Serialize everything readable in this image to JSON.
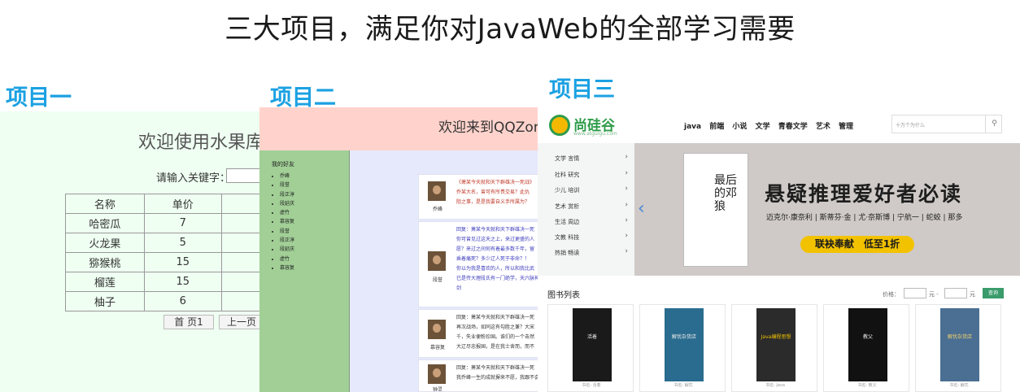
{
  "slide": {
    "title": "三大项目，满足你对JavaWeb的全部学习需要"
  },
  "labels": {
    "p1": "项目一",
    "p2": "项目二",
    "p3": "项目三"
  },
  "p1": {
    "title": "欢迎使用水果库",
    "search_label": "请输入关键字：",
    "columns": [
      "名称",
      "单价"
    ],
    "rows": [
      {
        "name": "哈密瓜",
        "price": "7"
      },
      {
        "name": "火龙果",
        "price": "5"
      },
      {
        "name": "猕猴桃",
        "price": "15"
      },
      {
        "name": "榴莲",
        "price": "15"
      },
      {
        "name": "柚子",
        "price": "6"
      }
    ],
    "pager": {
      "first": "首 页1",
      "prev": "上一页"
    }
  },
  "p2": {
    "title": "欢迎来到QQZone",
    "friends_title": "我的好友",
    "friends": [
      "乔峰",
      "段誉",
      "段正淳",
      "段延庆",
      "虚竹",
      "慕容复",
      "段誉",
      "段正淳",
      "段延庆",
      "虚竹",
      "慕容复"
    ],
    "posts": [
      {
        "name": "乔峰",
        "lines": "《萧某今天就和天下群雄决一死战》\n乔某大名，曾可有所畏交易？此仇\n阻之事，是是我要自义手所属为？",
        "style": "red"
      },
      {
        "name": "段誉",
        "lines": "回复：萧某今天就和天下群雄决一死\n你可曾见过这天之上，来过更盛的人\n愿？来过之间何有着最多数千年，留\n乘着痛死？多少辽人死于非命？！\n你以为我是喜欢的人，所以和我比武\n已是传大理段氏有一门绝学，天六脉神剑",
        "style": "reply"
      },
      {
        "name": "慕容复",
        "lines": "回复：萧某今天就和天下群雄决一死\n再次战场，如同这有勾胜之兼？大宋\n千，失业便粉珍国。谁们的一个击然\n大辽尽忠报国，是在我士舍而，而不",
        "style": "plain"
      },
      {
        "name": "钟灵",
        "lines": "回复：萧某今天就和天下群雄决一死\n我乔峰一生的成就摒来不愿，我跟不会",
        "style": "plain"
      }
    ]
  },
  "p3": {
    "logo_text": "尚硅谷",
    "logo_sub": "www.atguigu.com",
    "nav": [
      "java",
      "前端",
      "小说",
      "文学",
      "青春文学",
      "艺术",
      "管理"
    ],
    "search_placeholder": "十万个为什么",
    "categories": [
      "文学 言情",
      "社科 研究",
      "少儿 培训",
      "艺术 赏析",
      "生活 周边",
      "文教 科技",
      "热销 畅读"
    ],
    "banner": {
      "book_title": "最后的邓狼",
      "headline": "悬疑推理爱好者必读",
      "authors": "迈克尔·康奈利 | 斯蒂芬·金 | 尤·奈斯博 | 宁航一 | 蛇蛟 | 那多",
      "promo": "联袂奉献　低至1折"
    },
    "list_title": "图书列表",
    "price_label": "价格：",
    "price_unit_a": "元 -",
    "price_unit_b": "元",
    "query_label": "查询",
    "books": [
      {
        "title": "活着",
        "caption": "书名: 活着"
      },
      {
        "title": "解忧杂货店",
        "caption": "书名: 解忧"
      },
      {
        "title": "Java编程思想",
        "caption": "书名: Java"
      },
      {
        "title": "教父",
        "caption": "书名: 教父"
      },
      {
        "title": "解忧杂货店",
        "caption": "书名: 解忧"
      }
    ],
    "colors": {
      "brand_green": "#2f9c4a",
      "logo_yellow": "#f5b800",
      "query_green": "#3a9b6b",
      "promo_yellow": "#f2c200"
    }
  }
}
